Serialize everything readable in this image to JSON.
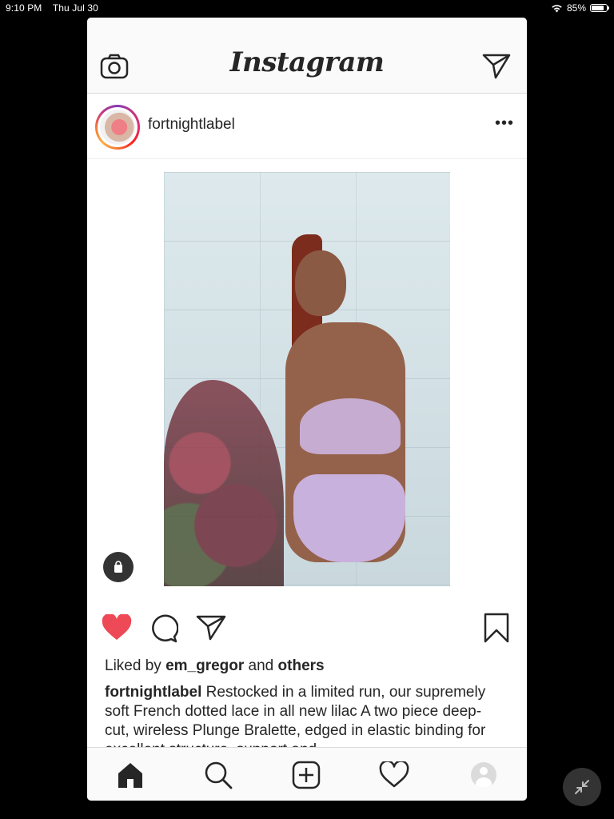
{
  "status_bar": {
    "time": "9:10 PM",
    "date": "Thu Jul 30",
    "battery": "85%",
    "battery_level": 0.85
  },
  "header": {
    "logo": "Instagram",
    "left_icon": "camera-icon",
    "right_icon": "direct-message-icon"
  },
  "post": {
    "username": "fortnightlabel",
    "more_icon": "more-icon",
    "image_description_icon": "shopping-bag-icon",
    "liked": {
      "prefix": "Liked by",
      "user": "em_gregor",
      "and": "and",
      "others": "others"
    },
    "caption": {
      "username": "fortnightlabel",
      "text": "Restocked in a limited run, our supremely soft French dotted lace in all new lilac  A two piece deep-cut, wireless Plunge Bralette, edged in elastic binding for excellent structure, support and"
    },
    "liked_state": true,
    "like_color": "#ed4956"
  },
  "tabs": [
    {
      "name": "home",
      "icon": "home-icon"
    },
    {
      "name": "search",
      "icon": "search-icon"
    },
    {
      "name": "new-post",
      "icon": "add-post-icon"
    },
    {
      "name": "activity",
      "icon": "heart-icon"
    },
    {
      "name": "profile",
      "icon": "profile-icon"
    }
  ],
  "floating_button": {
    "icon": "minimize-icon"
  }
}
